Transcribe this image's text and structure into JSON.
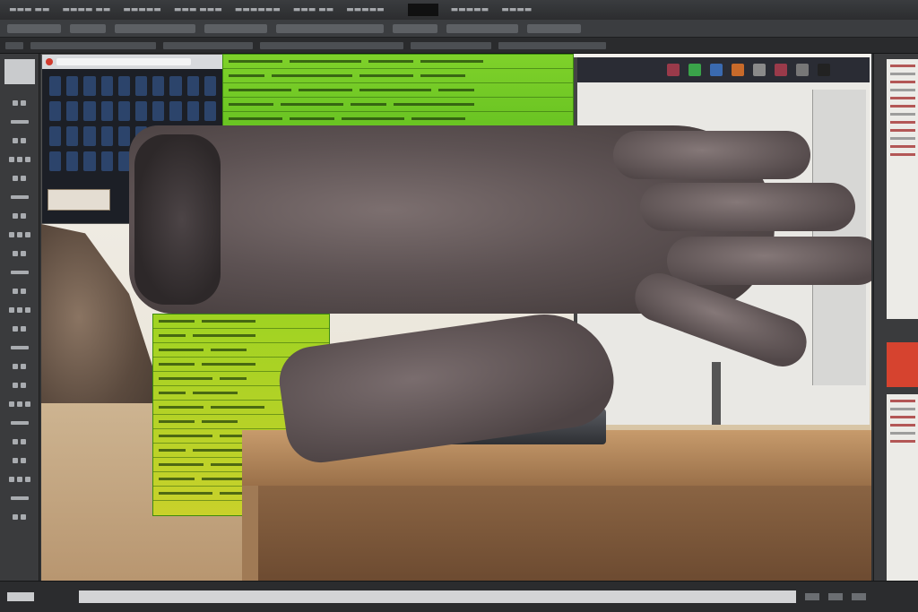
{
  "app": {
    "menu_items": [
      "☰ •••••",
      "•••• ••",
      "•••••••",
      "••••••",
      "•••• •••",
      "•••••",
      "••••••"
    ],
    "colors": {
      "accent_green": "#6fcc22",
      "accent_yellow": "#c9d12b",
      "chrome_dark": "#2f3133",
      "browser_tile": "#2f4b78",
      "monitor_strip": "#5b5fd6"
    }
  },
  "toolbar": {
    "tools": [
      "move-tool-icon",
      "marquee-tool-icon",
      "lasso-tool-icon",
      "crop-tool-icon",
      "eyedropper-tool-icon",
      "brush-tool-icon",
      "clone-tool-icon",
      "eraser-tool-icon",
      "gradient-tool-icon",
      "pen-tool-icon",
      "type-tool-icon",
      "path-tool-icon",
      "shape-tool-icon",
      "hand-tool-icon",
      "zoom-tool-icon"
    ]
  },
  "monitor": {
    "toolbar_icons": [
      "pinterest-icon",
      "app-green-icon",
      "facebook-icon",
      "app-orange-icon",
      "app-image-icon",
      "app-red-icon",
      "app-bird-icon",
      "app-dark-icon"
    ]
  }
}
